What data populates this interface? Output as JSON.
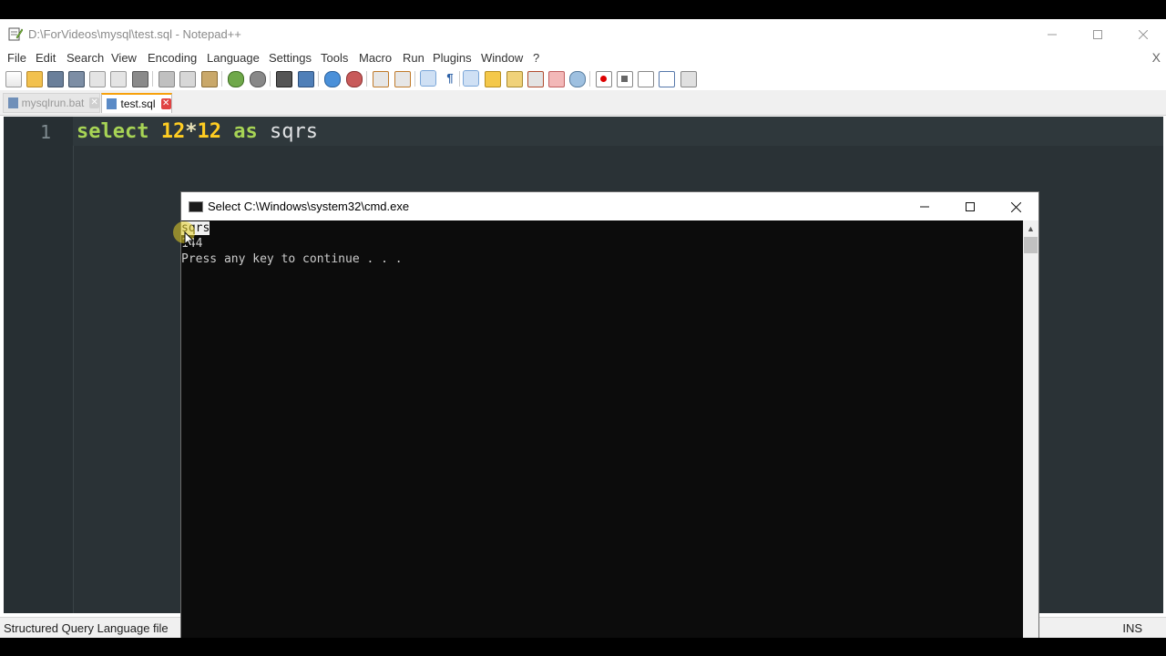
{
  "npp": {
    "title": "D:\\ForVideos\\mysql\\test.sql - Notepad++",
    "menu": [
      "File",
      "Edit",
      "Search",
      "View",
      "Encoding",
      "Language",
      "Settings",
      "Tools",
      "Macro",
      "Run",
      "Plugins",
      "Window",
      "?"
    ],
    "menu_close": "X",
    "tabs": [
      {
        "label": "mysqlrun.bat",
        "active": false
      },
      {
        "label": "test.sql",
        "active": true
      }
    ],
    "editor": {
      "line_number": "1",
      "tokens": {
        "kw1": "select",
        "num1": "12",
        "op": "*",
        "num2": "12",
        "kw2": "as",
        "id": "sqrs"
      }
    },
    "status": {
      "file_type": "Structured Query Language file",
      "mode": "INS"
    }
  },
  "cmd": {
    "title": "Select C:\\Windows\\system32\\cmd.exe",
    "lines": [
      "sqrs",
      "144",
      "Press any key to continue . . ."
    ]
  },
  "colors": {
    "keyword": "#a7d455",
    "number": "#ffcd22",
    "editor_bg": "#2a3236",
    "console_bg": "#0c0c0c",
    "tab_accent": "#f7a10c"
  }
}
